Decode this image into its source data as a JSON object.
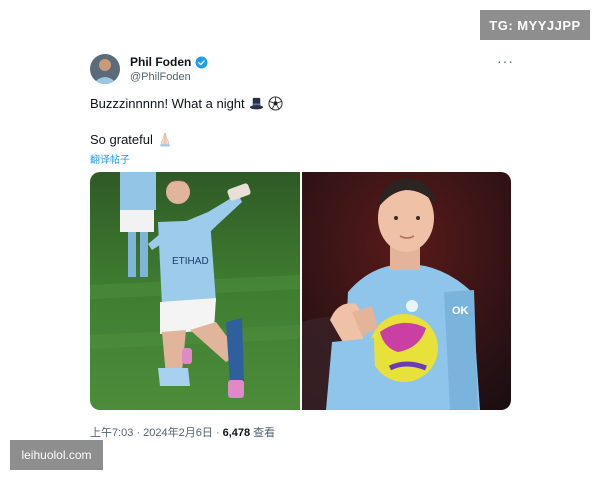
{
  "watermarks": {
    "top_right": "TG: MYYJJPP",
    "bottom_left": "leihuolol.com"
  },
  "tweet": {
    "author_name": "Phil Foden",
    "author_handle": "@PhilFoden",
    "verified_color": "#1d9bf0",
    "text_line1": "Buzzzinnnnn! What a night",
    "text_line2": "So grateful",
    "translate_label": "翻译帖子",
    "timestamp": "上午7:03 · 2024年2月6日 ·",
    "views_count": "6,478",
    "views_label": "查看",
    "icons": {
      "line1": [
        "top-hat-icon",
        "soccer-ball-icon"
      ],
      "line2": [
        "praying-hands-icon"
      ],
      "menu": "more-options-icon"
    }
  },
  "colors": {
    "accent": "#1d9bf0",
    "muted_text": "#536471",
    "jersey_blue": "#8ec6ea",
    "pitch_green": "#3d7a2e"
  }
}
